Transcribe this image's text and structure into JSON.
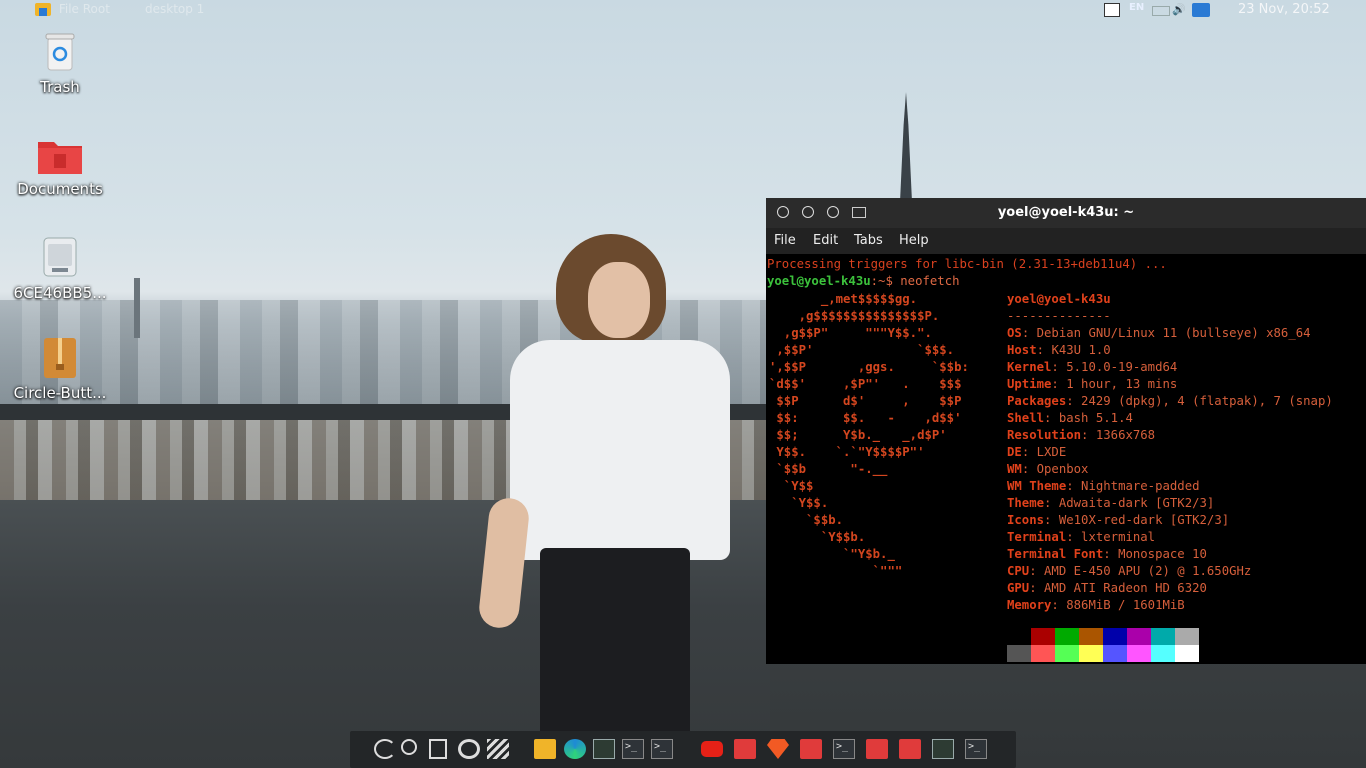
{
  "top_panel": {
    "file_root": "File Root",
    "desktop": "desktop 1",
    "lang": "EN",
    "clock": "23 Nov, 20:52"
  },
  "desktop_icons": [
    {
      "label": "Trash",
      "icon": "trash-icon"
    },
    {
      "label": "Documents",
      "icon": "folder-icon"
    },
    {
      "label": "6CE46BB5...",
      "icon": "drive-icon"
    },
    {
      "label": "Circle-Butt...",
      "icon": "archive-icon"
    }
  ],
  "terminal": {
    "title": "yoel@yoel-k43u: ~",
    "menu": [
      "File",
      "Edit",
      "Tabs",
      "Help"
    ],
    "line1": "Processing triggers for libc-bin (2.31-13+deb11u4) ...",
    "prompt_user": "yoel@yoel-k43u",
    "prompt_rest": ":~$ neofetch",
    "neofetch_user": "yoel@yoel-k43u",
    "separator": "--------------",
    "info": [
      {
        "key": "OS",
        "value": "Debian GNU/Linux 11 (bullseye) x86_64"
      },
      {
        "key": "Host",
        "value": "K43U 1.0"
      },
      {
        "key": "Kernel",
        "value": "5.10.0-19-amd64"
      },
      {
        "key": "Uptime",
        "value": "1 hour, 13 mins"
      },
      {
        "key": "Packages",
        "value": "2429 (dpkg), 4 (flatpak), 7 (snap)"
      },
      {
        "key": "Shell",
        "value": "bash 5.1.4"
      },
      {
        "key": "Resolution",
        "value": "1366x768"
      },
      {
        "key": "DE",
        "value": "LXDE"
      },
      {
        "key": "WM",
        "value": "Openbox"
      },
      {
        "key": "WM Theme",
        "value": "Nightmare-padded"
      },
      {
        "key": "Theme",
        "value": "Adwaita-dark [GTK2/3]"
      },
      {
        "key": "Icons",
        "value": "We10X-red-dark [GTK2/3]"
      },
      {
        "key": "Terminal",
        "value": "lxterminal"
      },
      {
        "key": "Terminal Font",
        "value": "Monospace 10"
      },
      {
        "key": "CPU",
        "value": "AMD E-450 APU (2) @ 1.650GHz"
      },
      {
        "key": "GPU",
        "value": "AMD ATI Radeon HD 6320"
      },
      {
        "key": "Memory",
        "value": "886MiB / 1601MiB"
      }
    ],
    "ascii_art": "       _,met$$$$$gg.\n    ,g$$$$$$$$$$$$$$$P.\n  ,g$$P\"     \"\"\"Y$$.\".\n ,$$P'              `$$$.\n',$$P       ,ggs.     `$$b:\n`d$$'     ,$P\"'   .    $$$\n $$P      d$'     ,    $$P\n $$:      $$.   -    ,d$$'\n $$;      Y$b._   _,d$P'\n Y$$.    `.`\"Y$$$$P\"'\n `$$b      \"-.__\n  `Y$$\n   `Y$$.\n     `$$b.\n       `Y$$b.\n          `\"Y$b._\n              `\"\"\"",
    "palette_top": [
      "#000000",
      "#aa0000",
      "#00aa00",
      "#aa5500",
      "#0000aa",
      "#aa00aa",
      "#00aaaa",
      "#aaaaaa"
    ],
    "palette_bottom": [
      "#555555",
      "#ff5555",
      "#55ff55",
      "#ffff55",
      "#5555ff",
      "#ff55ff",
      "#55ffff",
      "#ffffff"
    ]
  },
  "taskbar": {
    "items": [
      "debian-logo-icon",
      "search-icon",
      "task-view-icon",
      "media-icon",
      "clapper-icon",
      "file-manager-icon",
      "edge-icon",
      "system-monitor-icon",
      "terminal-icon",
      "terminal-icon",
      "youtube-icon",
      "folder-icon",
      "brave-icon",
      "folder-icon",
      "terminal-icon",
      "folder-icon",
      "folder-icon",
      "system-monitor-icon",
      "terminal-icon"
    ]
  }
}
